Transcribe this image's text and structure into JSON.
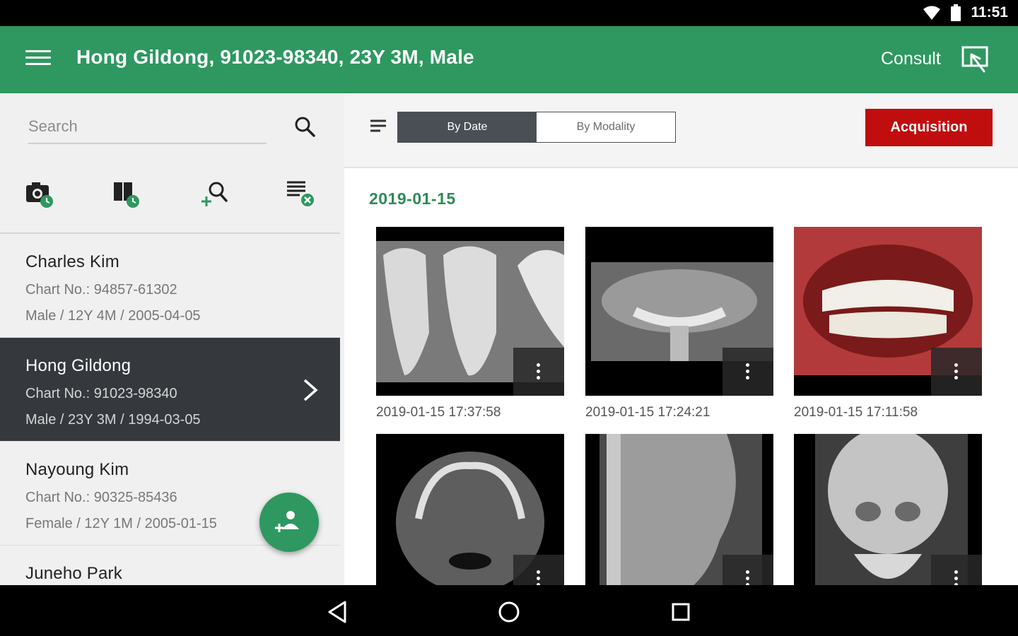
{
  "status_bar": {
    "time": "11:51"
  },
  "app_bar": {
    "title": "Hong Gildong, 91023-98340, 23Y 3M, Male",
    "consult_label": "Consult"
  },
  "search": {
    "placeholder": "Search"
  },
  "patients": [
    {
      "name": "Charles Kim",
      "chart": "Chart No.: 94857-61302",
      "info": "Male / 12Y 4M / 2005-04-05"
    },
    {
      "name": "Hong Gildong",
      "chart": "Chart No.: 91023-98340",
      "info": "Male / 23Y 3M / 1994-03-05"
    },
    {
      "name": "Nayoung Kim",
      "chart": "Chart No.: 90325-85436",
      "info": "Female / 12Y 1M / 2005-01-15"
    },
    {
      "name": "Juneho Park",
      "chart": "",
      "info": ""
    }
  ],
  "view_toggle": {
    "by_date": "By Date",
    "by_modality": "By Modality",
    "selected": "By Date"
  },
  "acquisition_label": "Acquisition",
  "gallery": {
    "date": "2019-01-15",
    "images": [
      {
        "caption": "2019-01-15 17:37:58"
      },
      {
        "caption": "2019-01-15 17:24:21"
      },
      {
        "caption": "2019-01-15 17:11:58"
      },
      {
        "caption": ""
      },
      {
        "caption": ""
      },
      {
        "caption": ""
      }
    ]
  },
  "colors": {
    "primary": "#2e9860",
    "acquisition": "#c00d0d",
    "selected_row": "#35393e"
  }
}
